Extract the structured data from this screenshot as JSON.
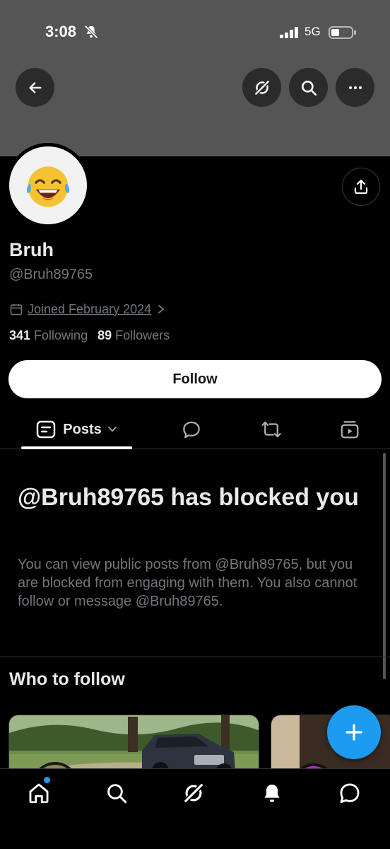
{
  "status_bar": {
    "time": "3:08",
    "network": "5G"
  },
  "profile": {
    "display_name": "Bruh",
    "handle": "@Bruh89765",
    "joined": "Joined February 2024",
    "following_count": "341",
    "following_label": "Following",
    "followers_count": "89",
    "followers_label": "Followers",
    "follow_button": "Follow",
    "avatar_icon": "rofl-emoji-icon"
  },
  "tabs": {
    "posts_label": "Posts"
  },
  "blocked": {
    "title": "@Bruh89765 has blocked you",
    "body": "You can view public posts from @Bruh89765, but you are blocked from engaging with them. You also cannot follow or message @Bruh89765."
  },
  "who_to_follow": {
    "title": "Who to follow"
  },
  "colors": {
    "accent": "#1d9bf0",
    "banner": "#555555",
    "background": "#000000",
    "muted": "#71767b"
  },
  "icons": [
    "back-arrow-icon",
    "grok-icon",
    "search-icon",
    "more-icon",
    "share-icon",
    "calendar-icon",
    "posts-icon",
    "reply-icon",
    "repost-icon",
    "media-icon",
    "compose-plus-icon",
    "home-icon",
    "notifications-icon",
    "messages-icon"
  ]
}
